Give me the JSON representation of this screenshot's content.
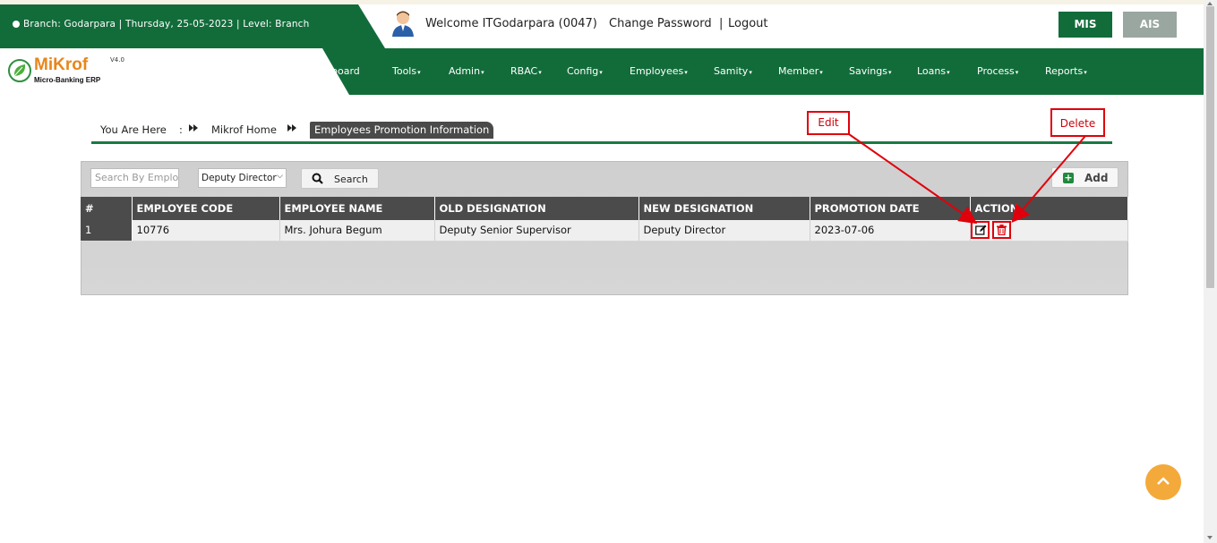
{
  "header": {
    "branch_info": "Branch: Godarpara | Thursday, 25-05-2023 | Level: Branch",
    "welcome": "Welcome ITGodarpara (0047)",
    "change_password": "Change Password",
    "separator": "|",
    "logout": "Logout",
    "mis_label": "MIS",
    "ais_label": "AIS"
  },
  "logo": {
    "name": "MiKrof",
    "version": "V4.0",
    "subtitle": "Micro-Banking ERP"
  },
  "nav": {
    "items": [
      "board",
      "Tools",
      "Admin",
      "RBAC",
      "Config",
      "Employees",
      "Samity",
      "Member",
      "Savings",
      "Loans",
      "Process",
      "Reports"
    ]
  },
  "breadcrumb": {
    "you_are_here": "You Are Here",
    "colon": ":",
    "home": "Mikrof Home",
    "current": "Employees Promotion Information"
  },
  "filters": {
    "search_placeholder": "Search By Employee",
    "designation_selected": "Deputy Director",
    "search_button": "Search",
    "add_button": "Add"
  },
  "table": {
    "headers": [
      "#",
      "EMPLOYEE CODE",
      "EMPLOYEE NAME",
      "OLD DESIGNATION",
      "NEW DESIGNATION",
      "PROMOTION DATE",
      "ACTION"
    ],
    "rows": [
      [
        "1",
        "10776",
        "Mrs. Johura Begum",
        "Deputy Senior Supervisor",
        "Deputy Director",
        "2023-07-06"
      ]
    ]
  },
  "annotations": {
    "edit": "Edit",
    "delete": "Delete"
  },
  "colors": {
    "brand_green": "#126c3a",
    "accent_orange": "#e8861a",
    "annotation_red": "#e0000b",
    "scroll_top": "#f4a93b"
  },
  "icons": [
    "user-avatar-icon",
    "leaf-logo-icon",
    "search-icon",
    "plus-icon",
    "edit-icon",
    "trash-icon",
    "chevron-up-icon",
    "double-chevron-right-icon"
  ]
}
